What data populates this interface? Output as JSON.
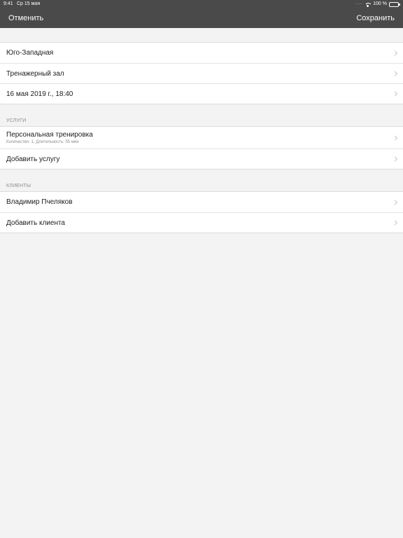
{
  "status_bar": {
    "time": "9:41",
    "date": "Ср 15 мая",
    "battery": "100 %"
  },
  "nav": {
    "cancel_label": "Отменить",
    "save_label": "Сохранить"
  },
  "details": {
    "location": "Юго-Западная",
    "room": "Тренажерный зал",
    "datetime": "16 мая 2019 г., 18:40"
  },
  "services": {
    "header": "УСЛУГИ",
    "items": [
      {
        "title": "Персональная тренировка",
        "subtitle": "Количество: 1, Длительность: 55 мин"
      }
    ],
    "add_label": "Добавить услугу"
  },
  "clients": {
    "header": "КЛИЕНТЫ",
    "items": [
      {
        "name": "Владимир Пчеляков"
      }
    ],
    "add_label": "Добавить клиента"
  }
}
